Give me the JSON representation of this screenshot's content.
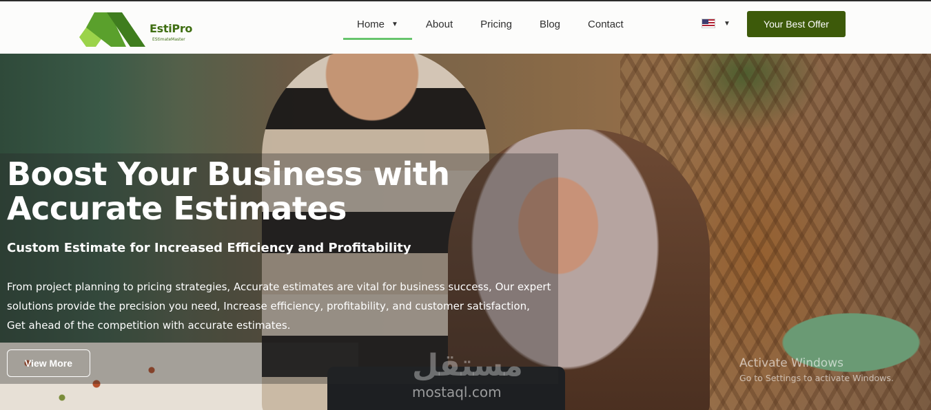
{
  "header": {
    "logo": {
      "title": "EstiPro",
      "subtitle": "EStimateMaster",
      "colors": [
        "#9bd34a",
        "#5aa02c",
        "#3f7d1e"
      ]
    },
    "nav": {
      "items": [
        {
          "label": "Home",
          "active": true,
          "has_dropdown": true
        },
        {
          "label": "About"
        },
        {
          "label": "Pricing"
        },
        {
          "label": "Blog"
        },
        {
          "label": "Contact"
        }
      ]
    },
    "language": {
      "icon": "us-flag-icon",
      "has_dropdown": true
    },
    "cta_label": "Your Best Offer"
  },
  "hero": {
    "title": "Boost Your Business with Accurate Estimates",
    "subtitle": "Custom Estimate for Increased Efficiency and Profitability",
    "body": "From project planning to pricing strategies, Accurate estimates are vital for business success, Our expert solutions provide the precision you need, Increase efficiency, profitability, and customer satisfaction, Get ahead of the competition with accurate estimates.",
    "button_label": "View More"
  },
  "watermark": {
    "arabic": "مستقل",
    "latin": "mostaql.com"
  },
  "windows_notice": {
    "title": "Activate Windows",
    "detail": "Go to Settings to activate Windows."
  },
  "colors": {
    "accent": "#3d5a0a",
    "nav_underline": "#66c46c"
  }
}
